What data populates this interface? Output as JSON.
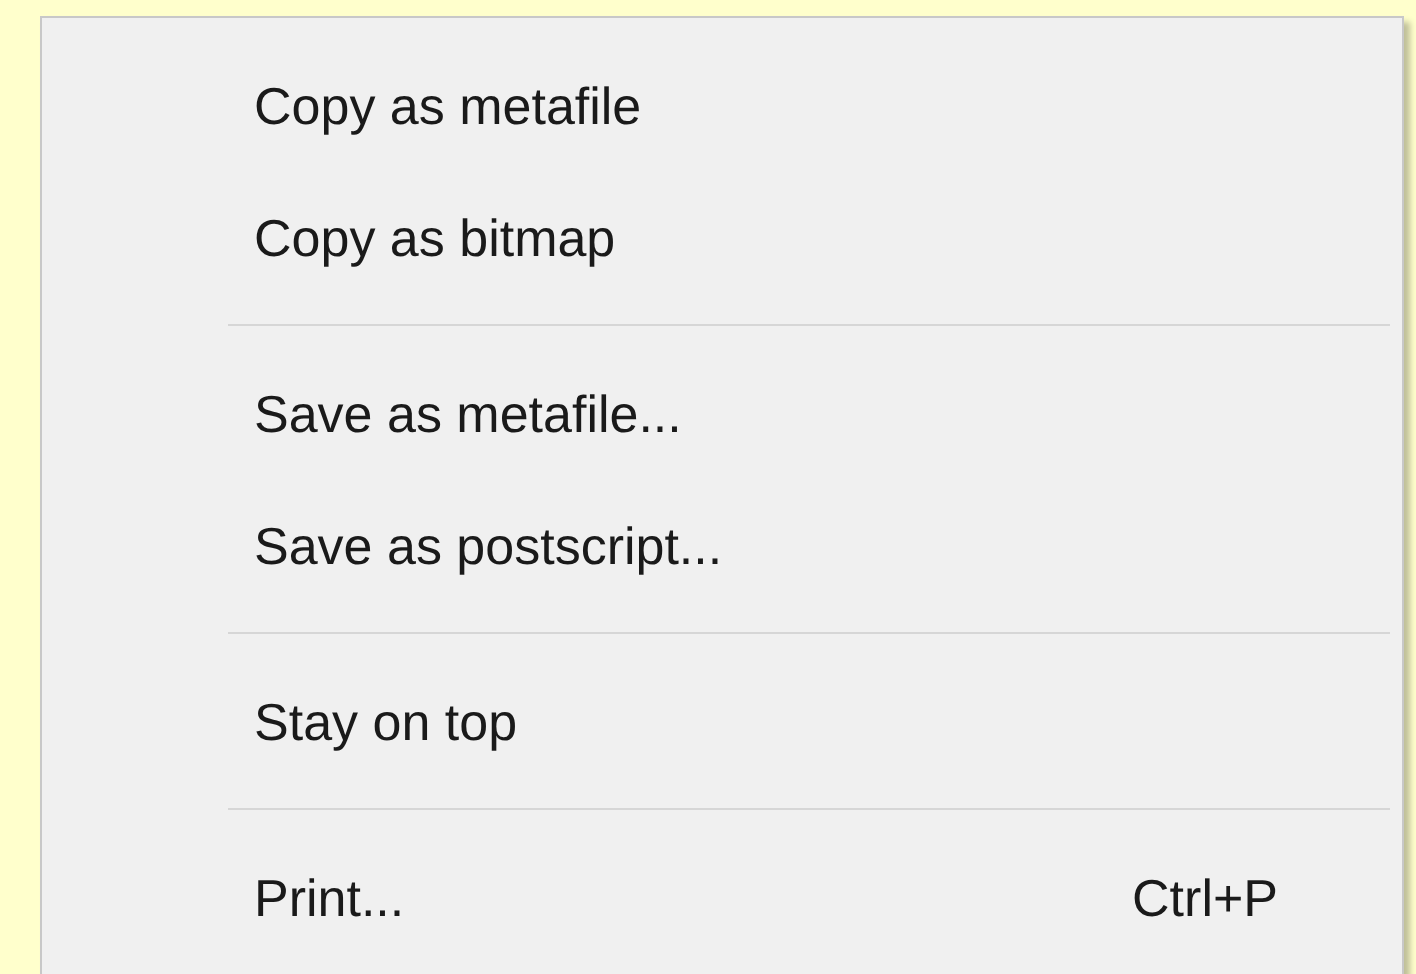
{
  "menu": {
    "items": [
      {
        "kind": "item",
        "label": "Copy as metafile"
      },
      {
        "kind": "item",
        "label": "Copy as bitmap"
      },
      {
        "kind": "separator"
      },
      {
        "kind": "item",
        "label": "Save as metafile..."
      },
      {
        "kind": "item",
        "label": "Save as postscript..."
      },
      {
        "kind": "separator"
      },
      {
        "kind": "item",
        "label": "Stay on top"
      },
      {
        "kind": "separator"
      },
      {
        "kind": "item",
        "label": "Print...",
        "shortcut": "Ctrl+P"
      }
    ]
  }
}
